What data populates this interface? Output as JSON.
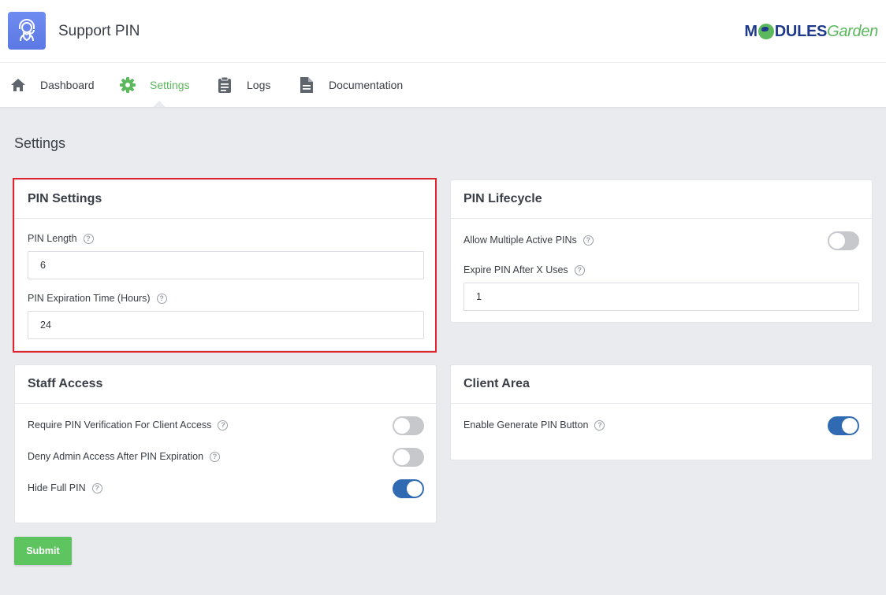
{
  "app": {
    "title": "Support PIN",
    "logo_icon": "headset-shield-icon"
  },
  "brand": {
    "part1": "M",
    "part2": "DULES",
    "part3": "Garden"
  },
  "nav": {
    "items": [
      {
        "label": "Dashboard",
        "icon": "home-icon"
      },
      {
        "label": "Settings",
        "icon": "gear-icon",
        "active": true
      },
      {
        "label": "Logs",
        "icon": "clipboard-icon"
      },
      {
        "label": "Documentation",
        "icon": "document-icon"
      }
    ]
  },
  "page": {
    "title": "Settings"
  },
  "pin_settings": {
    "title": "PIN Settings",
    "pin_length_label": "PIN Length",
    "pin_length_value": "6",
    "expiration_label": "PIN Expiration Time (Hours)",
    "expiration_value": "24"
  },
  "pin_lifecycle": {
    "title": "PIN Lifecycle",
    "multiple_label": "Allow Multiple Active PINs",
    "multiple_on": false,
    "expire_uses_label": "Expire PIN After X Uses",
    "expire_uses_value": "1"
  },
  "staff_access": {
    "title": "Staff Access",
    "require_label": "Require PIN Verification For Client Access",
    "require_on": false,
    "deny_label": "Deny Admin Access After PIN Expiration",
    "deny_on": false,
    "hide_label": "Hide Full PIN",
    "hide_on": true
  },
  "client_area": {
    "title": "Client Area",
    "generate_label": "Enable Generate PIN Button",
    "generate_on": true
  },
  "help_glyph": "?",
  "submit_label": "Submit",
  "colors": {
    "accent_green": "#5bb85c",
    "toggle_on": "#2f6ab3",
    "highlight_red": "#e0242e"
  }
}
